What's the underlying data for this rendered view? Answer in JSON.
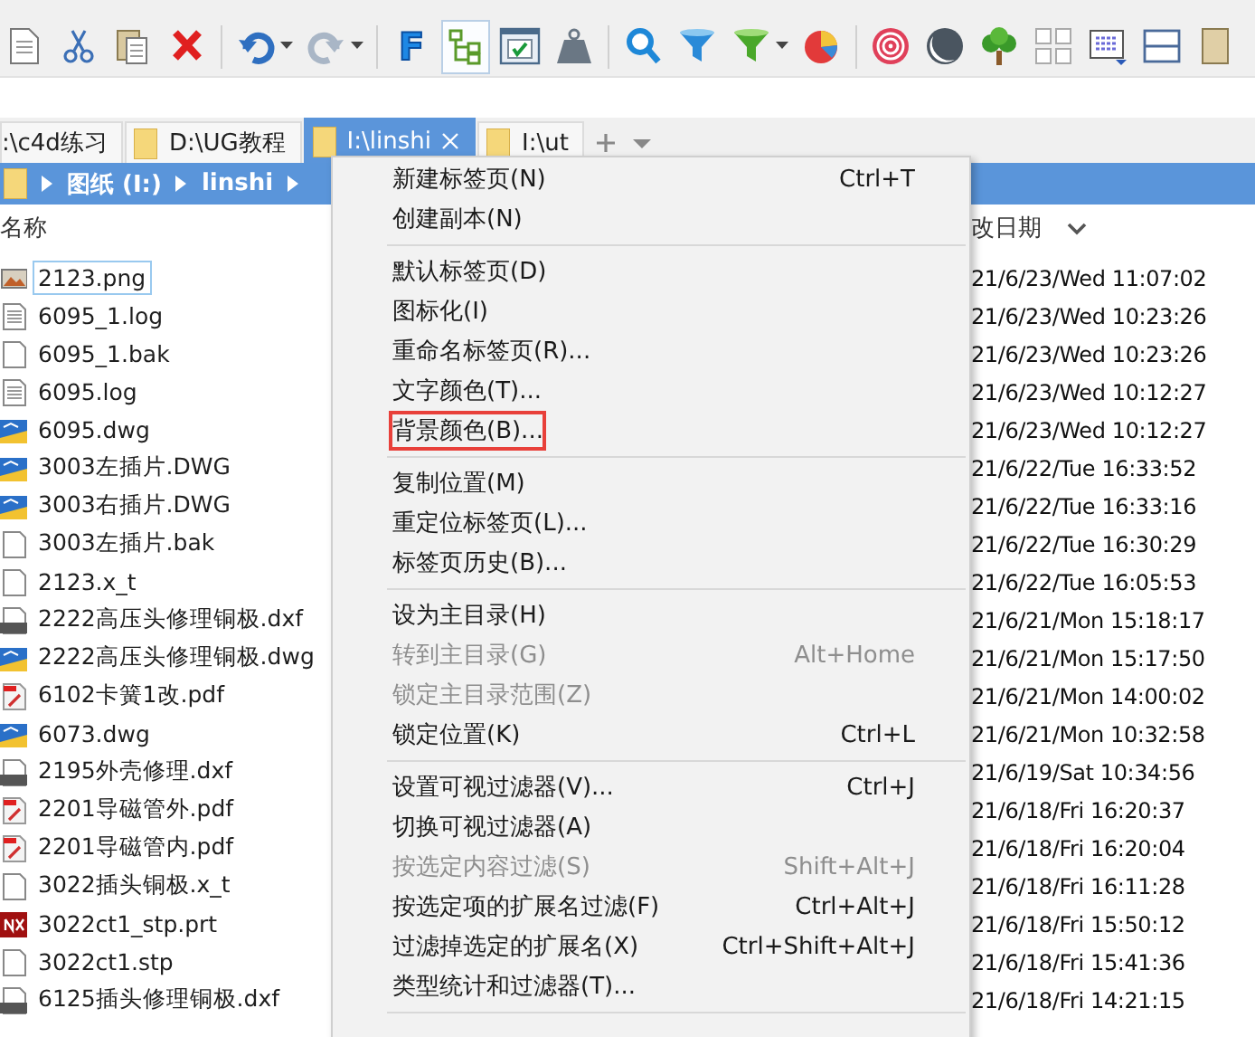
{
  "toolbar": {
    "buttons": [
      {
        "pressed": false,
        "dropdown": false
      },
      {
        "pressed": false,
        "dropdown": false
      },
      {
        "pressed": false,
        "dropdown": false
      },
      {
        "pressed": false,
        "dropdown": false
      },
      {
        "pressed": false,
        "dropdown": true
      },
      {
        "pressed": false,
        "dropdown": true
      },
      {
        "pressed": false,
        "dropdown": false,
        "glyph": "F"
      },
      {
        "pressed": true,
        "dropdown": false
      },
      {
        "pressed": false,
        "dropdown": false
      },
      {
        "pressed": false,
        "dropdown": false
      },
      {
        "pressed": false,
        "dropdown": false
      },
      {
        "pressed": false,
        "dropdown": false
      },
      {
        "pressed": false,
        "dropdown": true
      },
      {
        "pressed": false,
        "dropdown": false
      },
      {
        "pressed": false,
        "dropdown": false
      },
      {
        "pressed": false,
        "dropdown": false
      },
      {
        "pressed": false,
        "dropdown": false
      },
      {
        "pressed": false,
        "dropdown": false
      },
      {
        "pressed": false,
        "dropdown": false
      },
      {
        "pressed": false,
        "dropdown": false
      },
      {
        "pressed": false,
        "dropdown": false
      }
    ]
  },
  "tabs": [
    {
      "label": ":\\c4d练习",
      "selected": false
    },
    {
      "label": "D:\\UG教程",
      "selected": false
    },
    {
      "label": "I:\\linshi",
      "selected": true
    },
    {
      "label": "I:\\ut",
      "selected": false
    }
  ],
  "breadcrumb": [
    "图纸 (I:)",
    "linshi"
  ],
  "columns": {
    "name": "名称",
    "date": "改日期"
  },
  "rows": [
    {
      "name": "2123.png",
      "kind": "image",
      "date": "21/6/23/Wed 11:07:02",
      "selected": true
    },
    {
      "name": "6095_1.log",
      "kind": "text",
      "date": "21/6/23/Wed 10:23:26",
      "selected": false
    },
    {
      "name": "6095_1.bak",
      "kind": "blank",
      "date": "21/6/23/Wed 10:23:26",
      "selected": false
    },
    {
      "name": "6095.log",
      "kind": "text",
      "date": "21/6/23/Wed 10:12:27",
      "selected": false
    },
    {
      "name": "6095.dwg",
      "kind": "dwg",
      "date": "21/6/23/Wed 10:12:27",
      "selected": false
    },
    {
      "name": "3003左插片.DWG",
      "kind": "dwg",
      "date": "21/6/22/Tue 16:33:52",
      "selected": false
    },
    {
      "name": "3003右插片.DWG",
      "kind": "dwg",
      "date": "21/6/22/Tue 16:33:16",
      "selected": false
    },
    {
      "name": "3003左插片.bak",
      "kind": "blank",
      "date": "21/6/22/Tue 16:30:29",
      "selected": false
    },
    {
      "name": "2123.x_t",
      "kind": "blank",
      "date": "21/6/22/Tue 16:05:53",
      "selected": false
    },
    {
      "name": "2222高压头修理铜极.dxf",
      "kind": "dxf",
      "date": "21/6/21/Mon 15:18:17",
      "selected": false
    },
    {
      "name": "2222高压头修理铜极.dwg",
      "kind": "dwg",
      "date": "21/6/21/Mon 15:17:50",
      "selected": false
    },
    {
      "name": "6102卡簧1改.pdf",
      "kind": "pdf",
      "date": "21/6/21/Mon 14:00:02",
      "selected": false
    },
    {
      "name": "6073.dwg",
      "kind": "dwg",
      "date": "21/6/21/Mon 10:32:58",
      "selected": false
    },
    {
      "name": "2195外壳修理.dxf",
      "kind": "dxf",
      "date": "21/6/19/Sat 10:34:56",
      "selected": false
    },
    {
      "name": "2201导磁管外.pdf",
      "kind": "pdf",
      "date": "21/6/18/Fri 16:20:37",
      "selected": false
    },
    {
      "name": "2201导磁管内.pdf",
      "kind": "pdf",
      "date": "21/6/18/Fri 16:20:04",
      "selected": false
    },
    {
      "name": "3022插头铜极.x_t",
      "kind": "blank",
      "date": "21/6/18/Fri 16:11:28",
      "selected": false
    },
    {
      "name": "3022ct1_stp.prt",
      "kind": "nx",
      "date": "21/6/18/Fri 15:50:12",
      "selected": false
    },
    {
      "name": "3022ct1.stp",
      "kind": "blank",
      "date": "21/6/18/Fri 15:41:36",
      "selected": false
    },
    {
      "name": "6125插头修理铜极.dxf",
      "kind": "dxf",
      "date": "21/6/18/Fri 14:21:15",
      "selected": false
    }
  ],
  "context_menu": [
    {
      "kind": "item",
      "label": "新建标签页(N)",
      "shortcut": "Ctrl+T",
      "disabled": false,
      "highlighted": false
    },
    {
      "kind": "item",
      "label": "创建副本(N)",
      "disabled": false,
      "highlighted": false
    },
    {
      "kind": "separator"
    },
    {
      "kind": "item",
      "label": "默认标签页(D)",
      "disabled": false,
      "highlighted": false
    },
    {
      "kind": "item",
      "label": "图标化(I)",
      "disabled": false,
      "highlighted": false
    },
    {
      "kind": "item",
      "label": "重命名标签页(R)...",
      "disabled": false,
      "highlighted": false
    },
    {
      "kind": "item",
      "label": "文字颜色(T)...",
      "disabled": false,
      "highlighted": false
    },
    {
      "kind": "item",
      "label": "背景颜色(B)...",
      "disabled": false,
      "highlighted": true
    },
    {
      "kind": "separator"
    },
    {
      "kind": "item",
      "label": "复制位置(M)",
      "disabled": false,
      "highlighted": false
    },
    {
      "kind": "item",
      "label": "重定位标签页(L)...",
      "disabled": false,
      "highlighted": false
    },
    {
      "kind": "item",
      "label": "标签页历史(B)...",
      "disabled": false,
      "highlighted": false
    },
    {
      "kind": "separator"
    },
    {
      "kind": "item",
      "label": "设为主目录(H)",
      "disabled": false,
      "highlighted": false
    },
    {
      "kind": "item",
      "label": "转到主目录(G)",
      "shortcut": "Alt+Home",
      "disabled": true,
      "highlighted": false
    },
    {
      "kind": "item",
      "label": "锁定主目录范围(Z)",
      "disabled": true,
      "highlighted": false
    },
    {
      "kind": "item",
      "label": "锁定位置(K)",
      "shortcut": "Ctrl+L",
      "disabled": false,
      "highlighted": false
    },
    {
      "kind": "separator"
    },
    {
      "kind": "item",
      "label": "设置可视过滤器(V)...",
      "shortcut": "Ctrl+J",
      "disabled": false,
      "highlighted": false
    },
    {
      "kind": "item",
      "label": "切换可视过滤器(A)",
      "disabled": false,
      "highlighted": false
    },
    {
      "kind": "item",
      "label": "按选定内容过滤(S)",
      "shortcut": "Shift+Alt+J",
      "disabled": true,
      "highlighted": false
    },
    {
      "kind": "item",
      "label": "按选定项的扩展名过滤(F)",
      "shortcut": "Ctrl+Alt+J",
      "disabled": false,
      "highlighted": false
    },
    {
      "kind": "item",
      "label": "过滤掉选定的扩展名(X)",
      "shortcut": "Ctrl+Shift+Alt+J",
      "disabled": false,
      "highlighted": false
    },
    {
      "kind": "item",
      "label": "类型统计和过滤器(T)...",
      "disabled": false,
      "highlighted": false
    },
    {
      "kind": "separator"
    }
  ]
}
